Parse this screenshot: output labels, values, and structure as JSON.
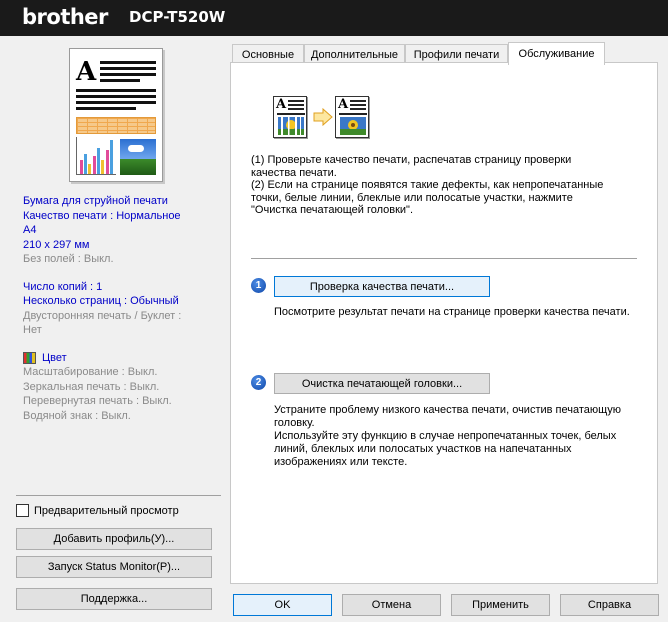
{
  "header": {
    "brand": "brother",
    "model": "DCP-T520W"
  },
  "summary": {
    "line1": "Бумага для струйной печати",
    "line2": "Качество печати : Нормальное",
    "line3": "A4",
    "line4": "210 x 297 мм",
    "line5": "Без полей : Выкл.",
    "line6": "Число копий : 1",
    "line7": "Несколько страниц : Обычный",
    "line8": "Двусторонняя печать / Буклет :",
    "line9": "Нет",
    "color": "Цвет",
    "line10": "Масштабирование : Выкл.",
    "line11": "Зеркальная печать : Выкл.",
    "line12": "Перевернутая печать : Выкл.",
    "line13": "Водяной знак : Выкл."
  },
  "left": {
    "preview_label": "Предварительный просмотр",
    "add_profile": "Добавить профиль(У)...",
    "status_monitor": "Запуск Status Monitor(P)...",
    "support": "Поддержка..."
  },
  "tabs": [
    "Основные",
    "Дополнительные",
    "Профили печати",
    "Обслуживание"
  ],
  "maintenance": {
    "instr1": "(1) Проверьте качество печати, распечатав страницу проверки",
    "instr2": "качества печати.",
    "instr3": "(2) Если на странице появятся такие дефекты, как непропечатанные",
    "instr4": "точки, белые линии, блеклые или полосатые участки, нажмите",
    "instr5": "\"Очистка печатающей головки\".",
    "step1_num": "1",
    "step1_button": "Проверка качества печати...",
    "step1_desc": "Посмотрите результат печати на странице проверки качества печати.",
    "step2_num": "2",
    "step2_button": "Очистка печатающей головки...",
    "step2_desc1": "Устраните проблему низкого качества печати, очистив печатающую",
    "step2_desc2": "головку.",
    "step2_desc3": "Используйте эту функцию в случае непропечатанных точек, белых",
    "step2_desc4": "линий, блеклых или полосатых участков на напечатанных",
    "step2_desc5": "изображениях или тексте."
  },
  "footer": {
    "ok": "OK",
    "cancel": "Отмена",
    "apply": "Применить",
    "help": "Справка"
  }
}
